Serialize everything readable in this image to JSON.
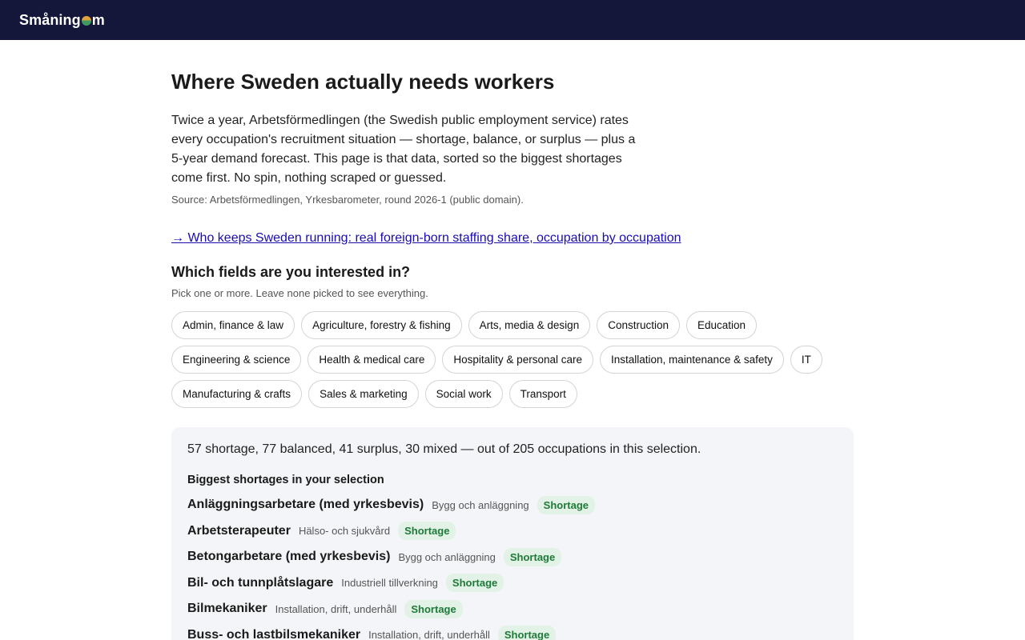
{
  "header": {
    "logo_before": "Småning",
    "logo_after": "m"
  },
  "title": "Where Sweden actually needs workers",
  "intro": "Twice a year, Arbetsförmedlingen (the Swedish public employment service) rates every occupation's recruitment situation — shortage, balance, or surplus — plus a 5-year demand forecast. This page is that data, sorted so the biggest shortages come first. No spin, nothing scraped or guessed.",
  "source": "Source: Arbetsförmedlingen, Yrkesbarometer, round 2026-1 (public domain).",
  "link_text": "→ Who keeps Sweden running: real foreign-born staffing share, occupation by occupation",
  "fields": {
    "heading": "Which fields are you interested in?",
    "hint": "Pick one or more. Leave none picked to see everything.",
    "chips": [
      "Admin, finance & law",
      "Agriculture, forestry & fishing",
      "Arts, media & design",
      "Construction",
      "Education",
      "Engineering & science",
      "Health & medical care",
      "Hospitality & personal care",
      "Installation, maintenance & safety",
      "IT",
      "Manufacturing & crafts",
      "Sales & marketing",
      "Social work",
      "Transport"
    ]
  },
  "results": {
    "summary": "57 shortage, 77 balanced, 41 surplus, 30 mixed — out of 205 occupations in this selection.",
    "heading": "Biggest shortages in your selection",
    "rows": [
      {
        "name": "Anläggningsarbetare (med yrkesbevis)",
        "field": "Bygg och anläggning",
        "status": "Shortage"
      },
      {
        "name": "Arbetsterapeuter",
        "field": "Hälso- och sjukvård",
        "status": "Shortage"
      },
      {
        "name": "Betongarbetare (med yrkesbevis)",
        "field": "Bygg och anläggning",
        "status": "Shortage"
      },
      {
        "name": "Bil- och tunnplåtslagare",
        "field": "Industriell tillverkning",
        "status": "Shortage"
      },
      {
        "name": "Bilmekaniker",
        "field": "Installation, drift, underhåll",
        "status": "Shortage"
      },
      {
        "name": "Buss- och lastbilsmekaniker",
        "field": "Installation, drift, underhåll",
        "status": "Shortage"
      }
    ]
  }
}
